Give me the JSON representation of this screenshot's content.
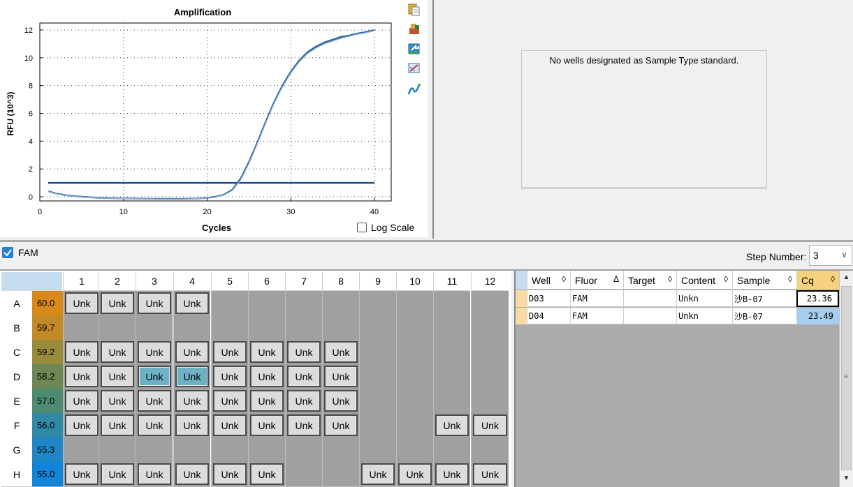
{
  "chart": {
    "title": "Amplification",
    "ylabel": "RFU (10^3)",
    "xlabel": "Cycles",
    "log_scale_label": "Log Scale",
    "log_scale_checked": false
  },
  "chart_data": {
    "type": "line",
    "title": "Amplification",
    "xlabel": "Cycles",
    "ylabel": "RFU (10^3)",
    "xlim": [
      0,
      42
    ],
    "ylim": [
      -0.3,
      12.5
    ],
    "xticks": [
      0,
      10,
      20,
      30,
      40
    ],
    "yticks": [
      0,
      2,
      4,
      6,
      8,
      10,
      12
    ],
    "grid": true,
    "threshold": 1.0,
    "threshold_color": "#1f4e8c",
    "series": [
      {
        "color": "#2b5f99",
        "x": [
          1,
          2,
          3,
          4,
          5,
          6,
          7,
          8,
          9,
          10,
          11,
          12,
          13,
          14,
          15,
          16,
          17,
          18,
          19,
          20,
          21,
          22,
          23,
          24,
          25,
          26,
          27,
          28,
          29,
          30,
          31,
          32,
          33,
          34,
          35,
          36,
          37,
          38,
          39,
          40
        ],
        "y": [
          0.4,
          0.22,
          0.12,
          0.05,
          0.0,
          -0.04,
          -0.07,
          -0.09,
          -0.11,
          -0.12,
          -0.13,
          -0.14,
          -0.14,
          -0.15,
          -0.15,
          -0.15,
          -0.15,
          -0.14,
          -0.12,
          -0.08,
          0.0,
          0.15,
          0.5,
          1.3,
          2.5,
          3.9,
          5.4,
          6.8,
          8.0,
          9.0,
          9.8,
          10.4,
          10.8,
          11.1,
          11.3,
          11.5,
          11.6,
          11.75,
          11.85,
          12.0
        ]
      },
      {
        "color": "#8fb6de",
        "x": [
          1,
          2,
          3,
          4,
          5,
          6,
          7,
          8,
          9,
          10,
          11,
          12,
          13,
          14,
          15,
          16,
          17,
          18,
          19,
          20,
          21,
          22,
          23,
          24,
          25,
          26,
          27,
          28,
          29,
          30,
          31,
          32,
          33,
          34,
          35,
          36,
          37,
          38,
          39,
          40
        ],
        "y": [
          0.38,
          0.2,
          0.1,
          0.04,
          -0.01,
          -0.05,
          -0.08,
          -0.1,
          -0.12,
          -0.13,
          -0.14,
          -0.15,
          -0.15,
          -0.16,
          -0.16,
          -0.16,
          -0.16,
          -0.15,
          -0.13,
          -0.09,
          -0.02,
          0.12,
          0.45,
          1.2,
          2.4,
          3.8,
          5.3,
          6.7,
          7.9,
          8.9,
          9.7,
          10.3,
          10.7,
          11.0,
          11.2,
          11.4,
          11.55,
          11.7,
          11.8,
          11.95
        ]
      }
    ]
  },
  "toolbar": [
    {
      "icon": "copy-icon"
    },
    {
      "icon": "print-icon"
    },
    {
      "icon": "export-icon"
    },
    {
      "icon": "chart-settings-icon"
    },
    {
      "icon": "curve-icon"
    }
  ],
  "standard_curve": {
    "message": "No wells designated as Sample Type standard."
  },
  "fluor": {
    "label": "FAM",
    "checked": true
  },
  "step": {
    "label": "Step Number:",
    "value": "3"
  },
  "plate": {
    "columns": [
      "1",
      "2",
      "3",
      "4",
      "5",
      "6",
      "7",
      "8",
      "9",
      "10",
      "11",
      "12"
    ],
    "rows": [
      {
        "label": "A",
        "temp": "60.0",
        "temp_color": "#d9891a",
        "wells": [
          "Unk",
          "Unk",
          "Unk",
          "Unk",
          "",
          "",
          "",
          "",
          "",
          "",
          "",
          ""
        ]
      },
      {
        "label": "B",
        "temp": "59.7",
        "temp_color": "#c28a26",
        "wells": [
          "",
          "",
          "",
          "",
          "",
          "",
          "",
          "",
          "",
          "",
          "",
          ""
        ]
      },
      {
        "label": "C",
        "temp": "59.2",
        "temp_color": "#9a8a3c",
        "wells": [
          "Unk",
          "Unk",
          "Unk",
          "Unk",
          "Unk",
          "Unk",
          "Unk",
          "Unk",
          "",
          "",
          "",
          ""
        ]
      },
      {
        "label": "D",
        "temp": "58.2",
        "temp_color": "#6e8754",
        "wells": [
          "Unk",
          "Unk",
          "Unk",
          "Unk",
          "Unk",
          "Unk",
          "Unk",
          "Unk",
          "",
          "",
          "",
          ""
        ]
      },
      {
        "label": "E",
        "temp": "57.0",
        "temp_color": "#4d8a72",
        "wells": [
          "Unk",
          "Unk",
          "Unk",
          "Unk",
          "Unk",
          "Unk",
          "Unk",
          "Unk",
          "",
          "",
          "",
          ""
        ]
      },
      {
        "label": "F",
        "temp": "56.0",
        "temp_color": "#2f8aa8",
        "wells": [
          "Unk",
          "Unk",
          "Unk",
          "Unk",
          "Unk",
          "Unk",
          "Unk",
          "Unk",
          "",
          "",
          "Unk",
          "Unk"
        ]
      },
      {
        "label": "G",
        "temp": "55.3",
        "temp_color": "#1f87c6",
        "wells": [
          "",
          "",
          "",
          "",
          "",
          "",
          "",
          "",
          "",
          "",
          "",
          ""
        ]
      },
      {
        "label": "H",
        "temp": "55.0",
        "temp_color": "#1284d8",
        "wells": [
          "Unk",
          "Unk",
          "Unk",
          "Unk",
          "Unk",
          "Unk",
          "",
          "",
          "Unk",
          "Unk",
          "Unk",
          "Unk"
        ]
      }
    ],
    "selected": [
      "D3",
      "D4"
    ]
  },
  "results": {
    "headers": [
      {
        "label": "Well",
        "sort": "◊"
      },
      {
        "label": "Fluor",
        "sort": "Δ"
      },
      {
        "label": "Target",
        "sort": "◊"
      },
      {
        "label": "Content",
        "sort": "◊"
      },
      {
        "label": "Sample",
        "sort": "◊"
      },
      {
        "label": "Cq",
        "sort": "◊"
      }
    ],
    "rows": [
      {
        "well": "D03",
        "fluor": "FAM",
        "target": "",
        "content": "Unkn",
        "sample": "沙B-07",
        "cq": "23.36"
      },
      {
        "well": "D04",
        "fluor": "FAM",
        "target": "",
        "content": "Unkn",
        "sample": "沙B-07",
        "cq": "23.49"
      }
    ]
  }
}
